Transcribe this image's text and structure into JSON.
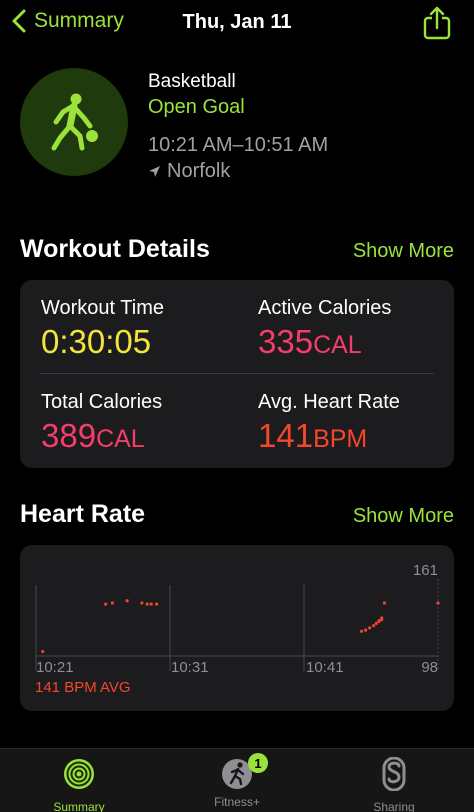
{
  "nav": {
    "back_label": "Summary",
    "title": "Thu, Jan 11"
  },
  "workout": {
    "name": "Basketball",
    "goal": "Open Goal",
    "time_range": "10:21 AM–10:51 AM",
    "location": "Norfolk"
  },
  "details": {
    "title": "Workout Details",
    "show_more": "Show More",
    "workout_time": {
      "label": "Workout Time",
      "value": "0:30:05"
    },
    "active_calories": {
      "label": "Active Calories",
      "value": "335",
      "unit": "CAL"
    },
    "total_calories": {
      "label": "Total Calories",
      "value": "389",
      "unit": "CAL"
    },
    "avg_heart_rate": {
      "label": "Avg. Heart Rate",
      "value": "141",
      "unit": "BPM"
    }
  },
  "heart_rate": {
    "title": "Heart Rate",
    "show_more": "Show More",
    "avg_label": "141 BPM AVG",
    "y_max_label": "161",
    "y_min_label": "98",
    "x_labels": [
      "10:21",
      "10:31",
      "10:41"
    ]
  },
  "chart_data": {
    "type": "scatter",
    "xlabel": "",
    "ylabel": "",
    "ylim": [
      98,
      161
    ],
    "xlim": [
      "10:21",
      "10:51"
    ],
    "x_ticks": [
      "10:21",
      "10:31",
      "10:41"
    ],
    "grid": true,
    "series": [
      {
        "x": [
          0.5,
          5.2,
          5.7,
          6.8,
          7.9,
          8.3,
          8.6,
          9.0,
          24.3,
          24.6,
          24.9,
          25.2,
          25.4,
          25.6,
          25.8,
          26.0,
          30.0
        ],
        "values": [
          102,
          144,
          145,
          147,
          145,
          144,
          144,
          144,
          120,
          121,
          123,
          125,
          127,
          129,
          131,
          145,
          145
        ]
      }
    ]
  },
  "tabs": [
    {
      "label": "Summary",
      "active": true,
      "icon": "activity-rings-icon"
    },
    {
      "label": "Fitness+",
      "active": false,
      "icon": "fitness-plus-icon",
      "badge": "1"
    },
    {
      "label": "Sharing",
      "active": false,
      "icon": "sharing-icon"
    }
  ],
  "colors": {
    "accent_green": "#9be33b",
    "workout_time": "#f2e53b",
    "calories": "#f43d69",
    "heart_rate": "#f5462d"
  }
}
